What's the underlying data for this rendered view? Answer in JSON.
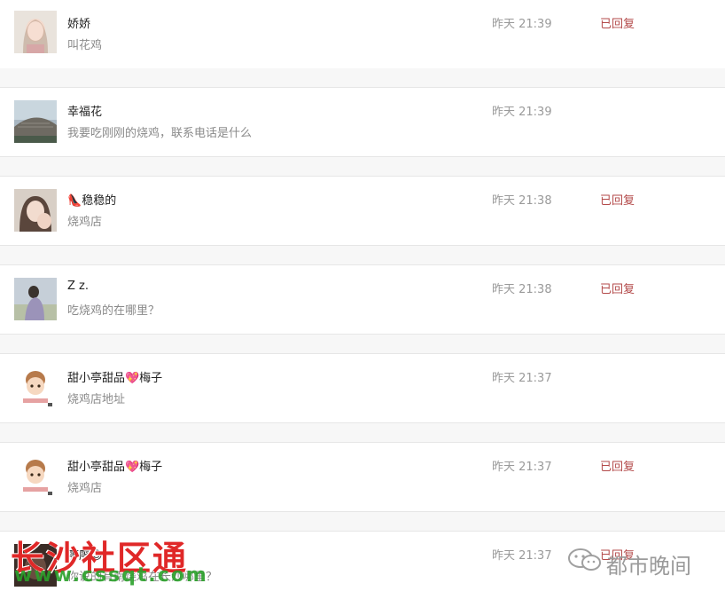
{
  "messages": [
    {
      "name": "娇娇",
      "text": "叫花鸡",
      "time": "昨天 21:39",
      "status": "已回复",
      "avatar": "girl-photo"
    },
    {
      "name": "幸福花",
      "text": "我要吃刚刚的烧鸡，联系电话是什么",
      "time": "昨天 21:39",
      "status": "",
      "avatar": "building-photo"
    },
    {
      "name": "稳稳的",
      "name_emoji": "👠",
      "text": "烧鸡店",
      "time": "昨天 21:38",
      "status": "已回复",
      "avatar": "selfie-photo"
    },
    {
      "name": "Z z.",
      "text": "吃烧鸡的在哪里？",
      "time": "昨天 21:38",
      "status": "已回复",
      "avatar": "portrait-photo"
    },
    {
      "name": "甜小亭甜品💖梅子",
      "text": "烧鸡店地址",
      "time": "昨天 21:37",
      "status": "",
      "avatar": "cartoon-girl"
    },
    {
      "name": "甜小亭甜品💖梅子",
      "text": "烧鸡店",
      "time": "昨天 21:37",
      "status": "已回复",
      "avatar": "cartoon-girl"
    },
    {
      "name": "廖廖",
      "name_emoji": "😊",
      "text": "你说的有南烧鸡在长沙哪里？",
      "time": "昨天 21:37",
      "status": "已回复",
      "avatar": "dark-photo"
    }
  ],
  "watermarks": {
    "left_title": "长沙社区通",
    "left_url": "www.cssqt.com",
    "right_text": "都市晚间",
    "right_icon": "wechat-icon"
  },
  "colors": {
    "status": "#b34a4a",
    "divider_bg": "#f7f7f7",
    "watermark_red": "#e02828",
    "watermark_green": "#2aa02a"
  }
}
